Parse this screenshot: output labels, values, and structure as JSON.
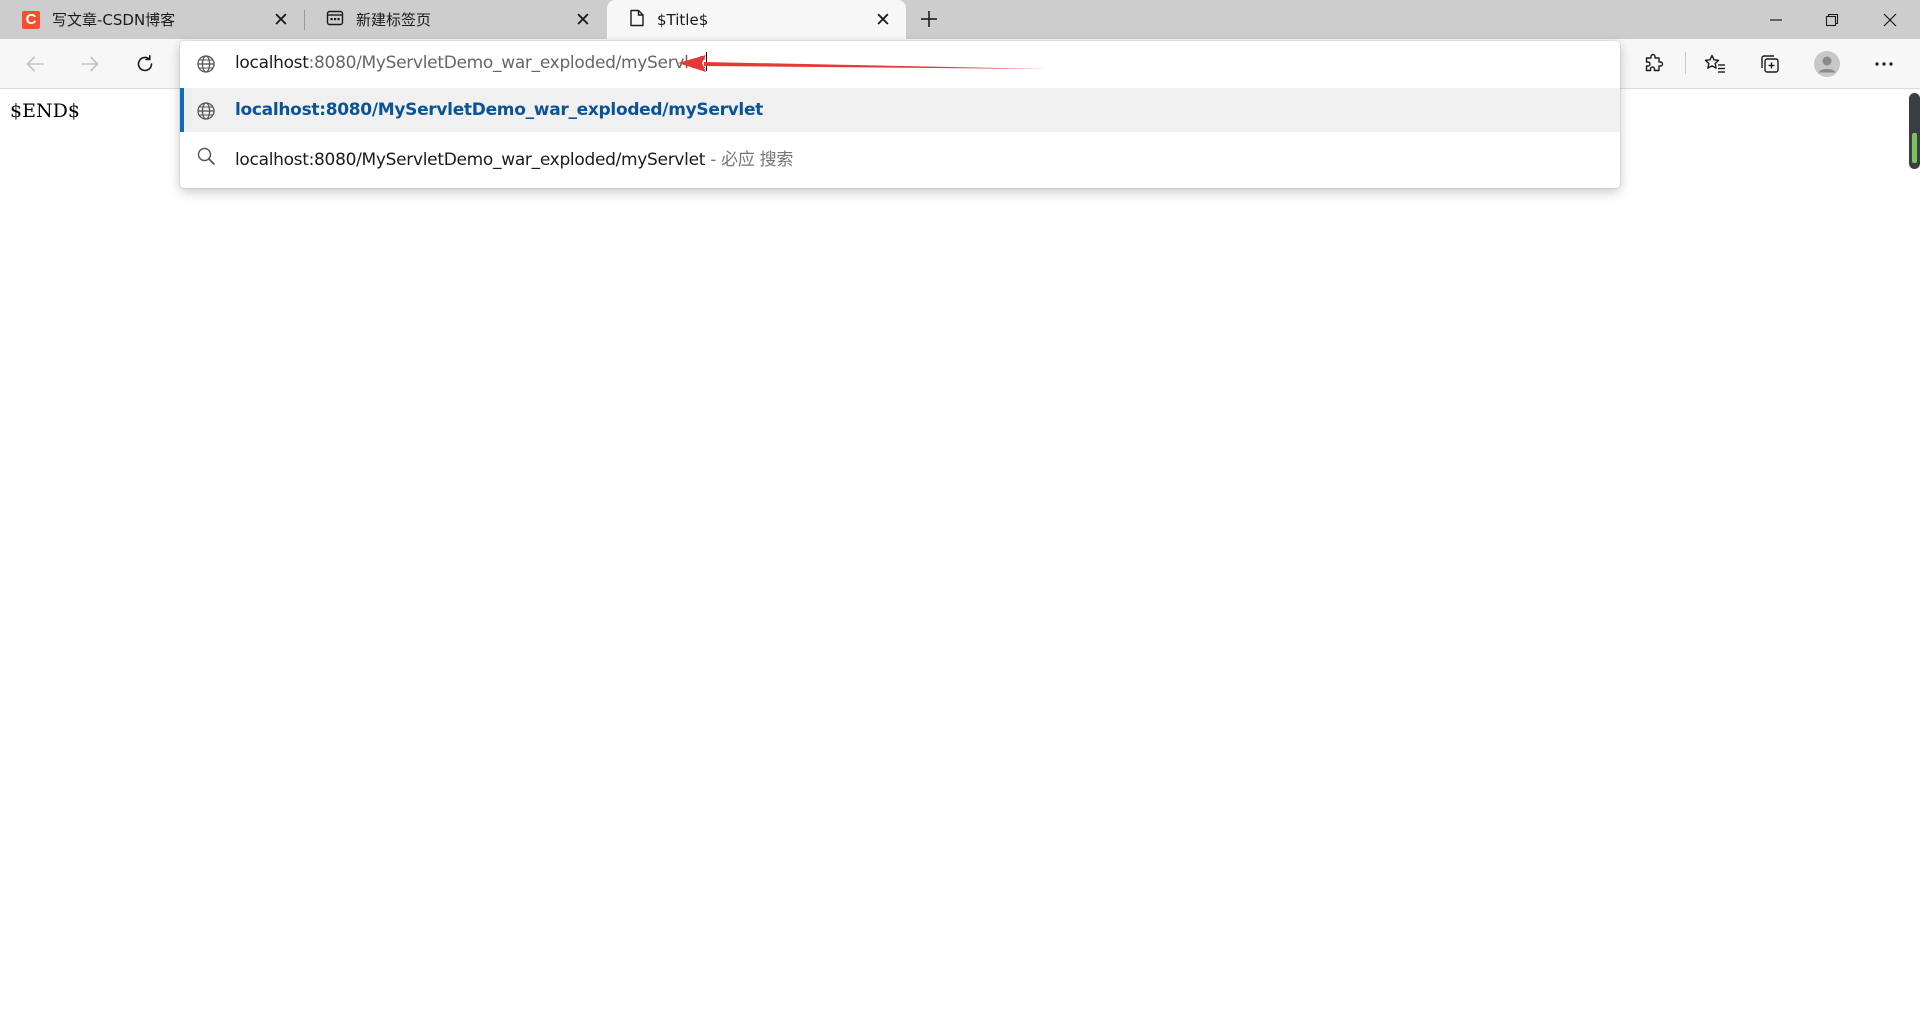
{
  "tabs": [
    {
      "title": "写文章-CSDN博客",
      "icon": "csdn-logo-icon",
      "active": false
    },
    {
      "title": "新建标签页",
      "icon": "new-tab-page-icon",
      "active": false
    },
    {
      "title": "$Title$",
      "icon": "document-icon",
      "active": true
    }
  ],
  "new_tab_icon": "plus-icon",
  "window_controls": [
    "minimize-icon",
    "restore-icon",
    "close-icon"
  ],
  "toolbar": {
    "left_buttons": [
      "back-arrow-icon",
      "forward-arrow-icon",
      "refresh-icon"
    ],
    "right_buttons": [
      "extensions-icon",
      "favorites-icon",
      "collections-icon",
      "profile-avatar-icon",
      "more-menu-icon"
    ]
  },
  "address_bar": {
    "host": "localhost",
    "path": ":8080/MyServletDemo_war_exploded/myServlet",
    "annotation_color": "#e53935"
  },
  "suggestions": [
    {
      "icon": "globe-icon",
      "text": "localhost:8080/MyServletDemo_war_exploded/myServlet",
      "suffix": "",
      "selected": true
    },
    {
      "icon": "search-icon",
      "text": "localhost:8080/MyServletDemo_war_exploded/myServlet",
      "suffix": " - 必应 搜索",
      "selected": false
    }
  ],
  "page": {
    "body_text": "$END$"
  },
  "colors": {
    "accent": "#0f6cbd",
    "tab_strip": "#cdcdcd",
    "toolbar": "#f7f7f7"
  }
}
